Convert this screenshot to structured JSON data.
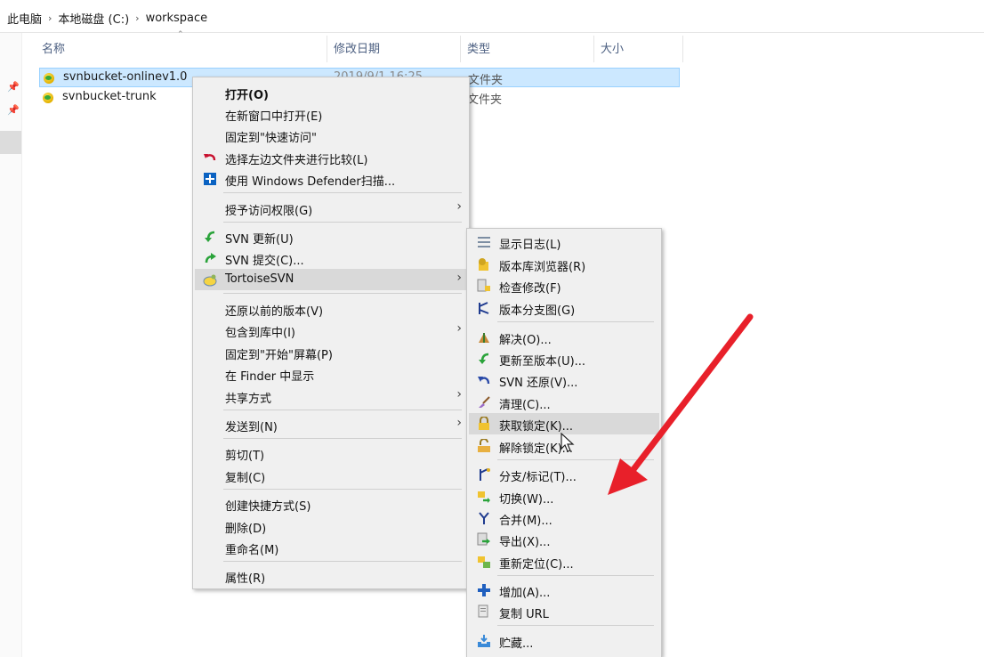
{
  "breadcrumb": {
    "items": [
      "此电脑",
      "本地磁盘 (C:)",
      "workspace"
    ],
    "separator": "›"
  },
  "columns": {
    "name": "名称",
    "date": "修改日期",
    "type": "类型",
    "size": "大小"
  },
  "files": [
    {
      "name": "svnbucket-onlinev1.0",
      "date": "2019/9/1 16:25",
      "type": "文件夹",
      "selected": true
    },
    {
      "name": "svnbucket-trunk",
      "date": "",
      "type": "文件夹",
      "selected": false
    }
  ],
  "context_menu": {
    "items": {
      "open": "打开(O)",
      "open_new_window": "在新窗口中打开(E)",
      "pin_quick_access": "固定到\"快速访问\"",
      "compare_left": "选择左边文件夹进行比较(L)",
      "defender_scan": "使用 Windows Defender扫描...",
      "grant_access": "授予访问权限(G)",
      "svn_update": "SVN 更新(U)",
      "svn_commit": "SVN 提交(C)...",
      "tortoisesvn": "TortoiseSVN",
      "restore_prev": "还原以前的版本(V)",
      "include_library": "包含到库中(I)",
      "pin_start": "固定到\"开始\"屏幕(P)",
      "show_finder": "在 Finder 中显示",
      "share_with": "共享方式",
      "send_to": "发送到(N)",
      "cut": "剪切(T)",
      "copy": "复制(C)",
      "create_shortcut": "创建快捷方式(S)",
      "delete": "删除(D)",
      "rename": "重命名(M)",
      "properties": "属性(R)"
    }
  },
  "tortoise_menu": {
    "items": {
      "show_log": "显示日志(L)",
      "repo_browser": "版本库浏览器(R)",
      "check_modifications": "检查修改(F)",
      "revision_graph": "版本分支图(G)",
      "resolve": "解决(O)...",
      "update_to_revision": "更新至版本(U)...",
      "svn_revert": "SVN 还原(V)...",
      "cleanup": "清理(C)...",
      "get_lock": "获取锁定(K)...",
      "release_lock": "解除锁定(K)...",
      "branch_tag": "分支/标记(T)...",
      "switch": "切换(W)...",
      "merge": "合并(M)...",
      "export": "导出(X)...",
      "relocate": "重新定位(C)...",
      "add": "增加(A)...",
      "copy_url": "复制 URL",
      "shelve": "贮藏..."
    },
    "highlighted": "get_lock"
  },
  "colors": {
    "selection_bg": "#cce8ff",
    "menu_bg": "#f0f0f0",
    "menu_highlight": "#d9d9d9",
    "annotation_arrow": "#e8202a",
    "header_text": "#4d6082"
  }
}
